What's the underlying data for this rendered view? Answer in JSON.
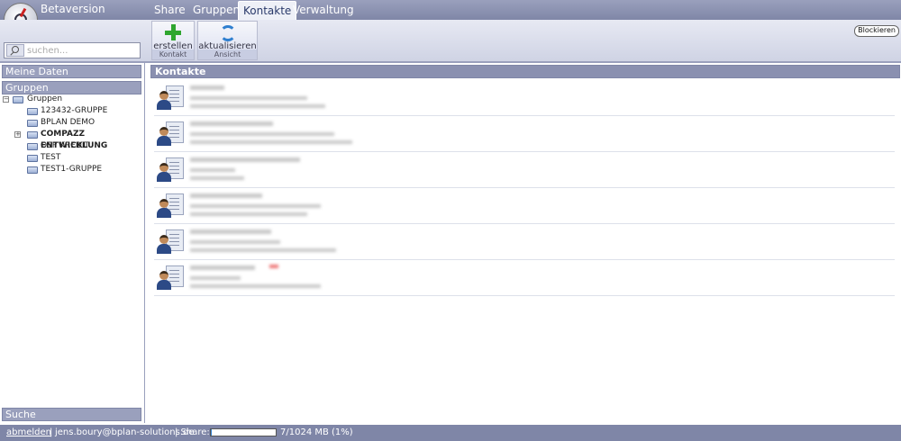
{
  "app": {
    "name": "Betaversion"
  },
  "tabs": [
    {
      "label": "Share",
      "active": false
    },
    {
      "label": "Gruppen",
      "active": false
    },
    {
      "label": "Kontakte",
      "active": true
    },
    {
      "label": "Verwaltung",
      "active": false
    }
  ],
  "search": {
    "placeholder": "suchen..."
  },
  "toolbar": {
    "create": {
      "label": "erstellen",
      "group": "Kontakt",
      "icon": "plus-icon"
    },
    "refresh": {
      "label": "aktualisieren",
      "group": "Ansicht",
      "icon": "refresh-icon"
    },
    "block_label": "Blockieren"
  },
  "sidebar": {
    "meine_daten": "Meine Daten",
    "gruppen_header": "Gruppen",
    "suche": "Suche",
    "tree": {
      "root": "Gruppen",
      "items": [
        {
          "label": "123432-GRUPPE",
          "bold": false,
          "expandable": false
        },
        {
          "label": "BPLAN DEMO",
          "bold": false,
          "expandable": false
        },
        {
          "label": "COMPAZZ ENTWICKLUNG",
          "bold": true,
          "expandable": true
        },
        {
          "label": "OSP KREDIT",
          "bold": false,
          "expandable": false
        },
        {
          "label": "TEST",
          "bold": false,
          "expandable": false
        },
        {
          "label": "TEST1-GRUPPE",
          "bold": false,
          "expandable": false
        }
      ]
    }
  },
  "content": {
    "title": "Kontakte",
    "contact_count": 6
  },
  "footer": {
    "logout": "abmelden",
    "separator": "|",
    "email": "jens.boury@bplan-solutions.de",
    "share_label": "| Share:",
    "share_usage": "7/1024 MB (1%)",
    "share_fraction": 0.01
  },
  "colors": {
    "header": "#7f86a7",
    "accent": "#2f7fcf",
    "add_green": "#2fa62f"
  }
}
